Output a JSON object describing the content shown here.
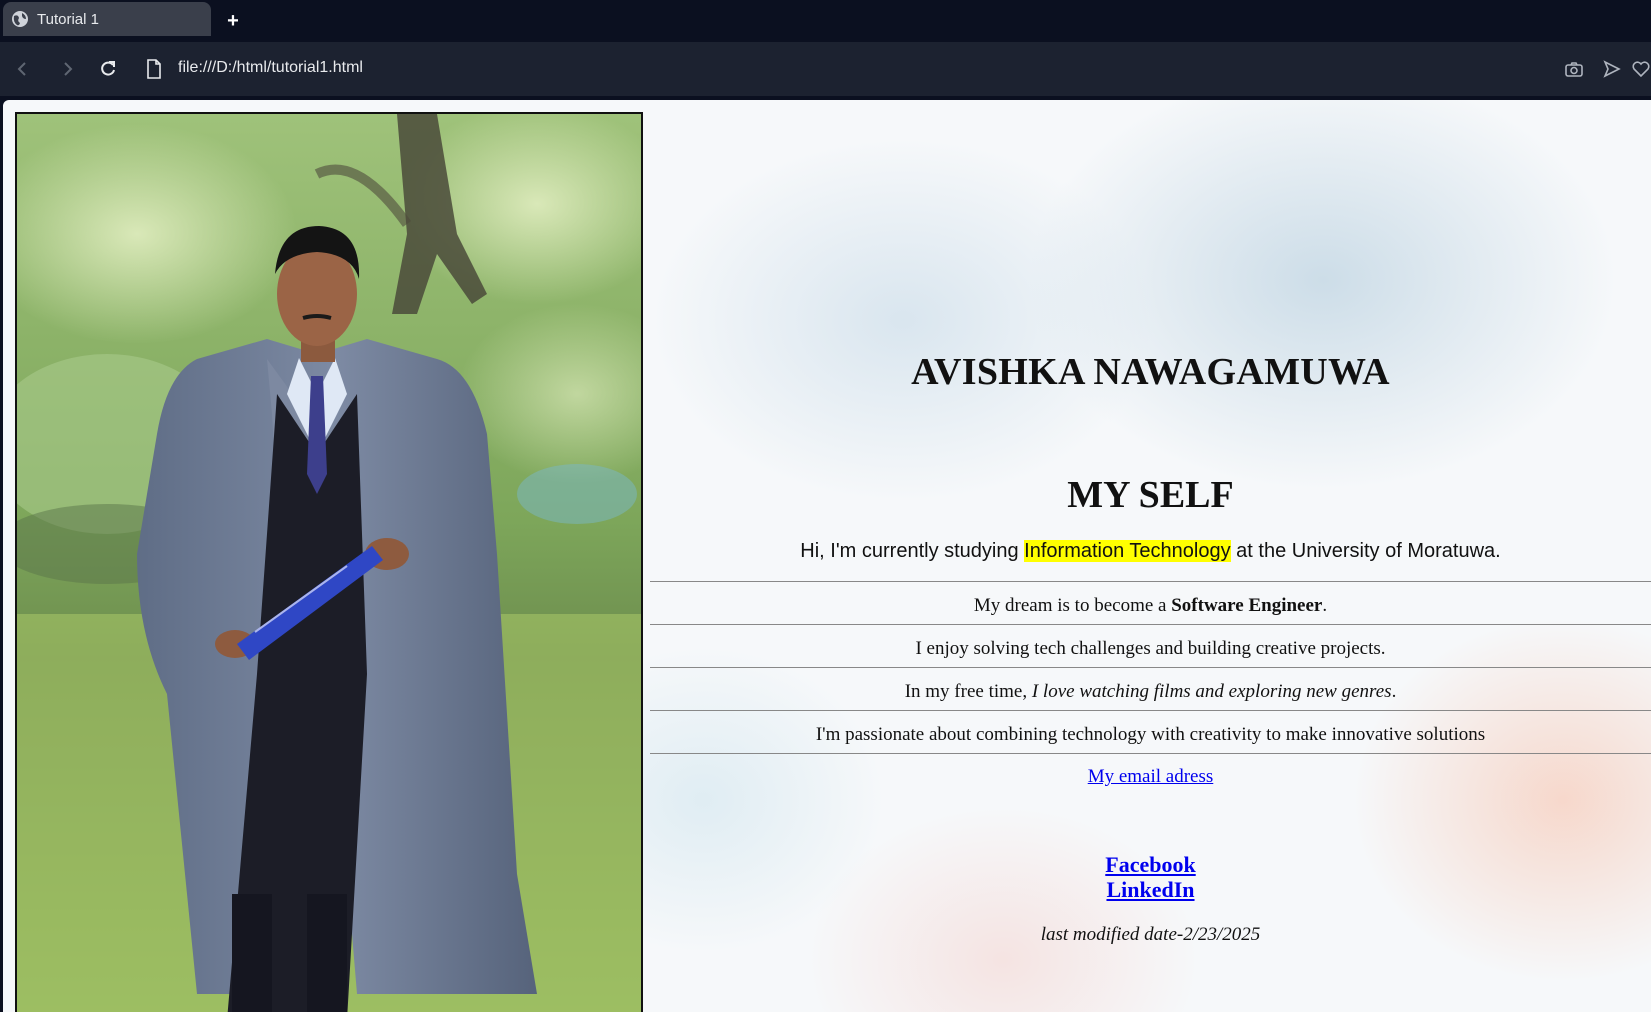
{
  "browser": {
    "tab_title": "Tutorial 1",
    "new_tab_label": "+",
    "url": "file:///D:/html/tutorial1.html"
  },
  "page": {
    "name_heading": "AVISHKA NAWAGAMUWA",
    "myself_heading": "MY SELF",
    "intro": {
      "before": "Hi, I'm currently studying ",
      "highlight": "Information Technology",
      "after": " at the University of Moratuwa."
    },
    "dream": {
      "before": "My dream is to become a ",
      "bold": "Software Engineer",
      "after": "."
    },
    "enjoy": "I enjoy solving tech challenges and building creative projects.",
    "freetime": {
      "before": "In my free time, ",
      "italic": "I love watching films and exploring new genres",
      "after": "."
    },
    "passion": "I'm passionate about combining technology with creativity to make innovative solutions",
    "email_link": "My email adress",
    "facebook_link": "Facebook",
    "linkedin_link": "LinkedIn",
    "last_modified": "last modified date-2/23/2025"
  },
  "colors": {
    "highlight": "#ffff00",
    "link": "#0000ee"
  }
}
